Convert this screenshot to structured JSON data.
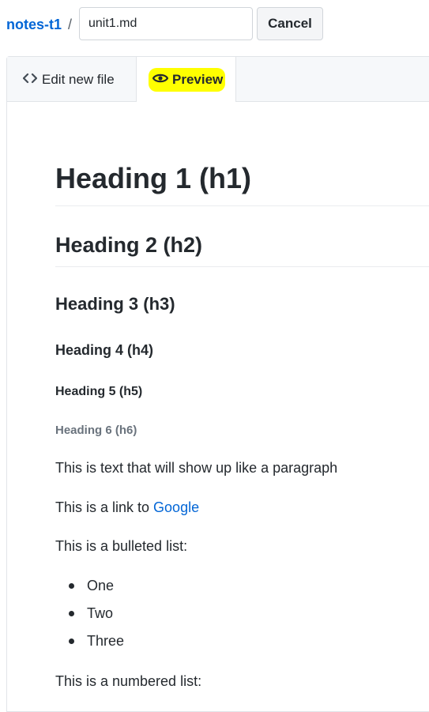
{
  "breadcrumb": {
    "repo": "notes-t1",
    "separator": "/",
    "filename_value": "unit1.md",
    "cancel_label": "Cancel"
  },
  "tabs": {
    "edit": {
      "label": "Edit new file",
      "icon": "code-icon"
    },
    "preview": {
      "label": "Preview",
      "icon": "eye-icon",
      "active": true,
      "highlight_color": "#ffff00"
    }
  },
  "preview": {
    "h1": "Heading 1 (h1)",
    "h2": "Heading 2 (h2)",
    "h3": "Heading 3 (h3)",
    "h4": "Heading 4 (h4)",
    "h5": "Heading 5 (h5)",
    "h6": "Heading 6 (h6)",
    "paragraph": "This is text that will show up like a paragraph",
    "link_prefix": "This is a link to ",
    "link_text": "Google",
    "bulleted_intro": "This is a bulleted list:",
    "bullets": [
      "One",
      "Two",
      "Three"
    ],
    "numbered_intro": "This is a numbered list:"
  },
  "colors": {
    "link": "#0366d6",
    "text": "#24292e",
    "muted": "#6a737d",
    "highlight": "#ffff00"
  }
}
